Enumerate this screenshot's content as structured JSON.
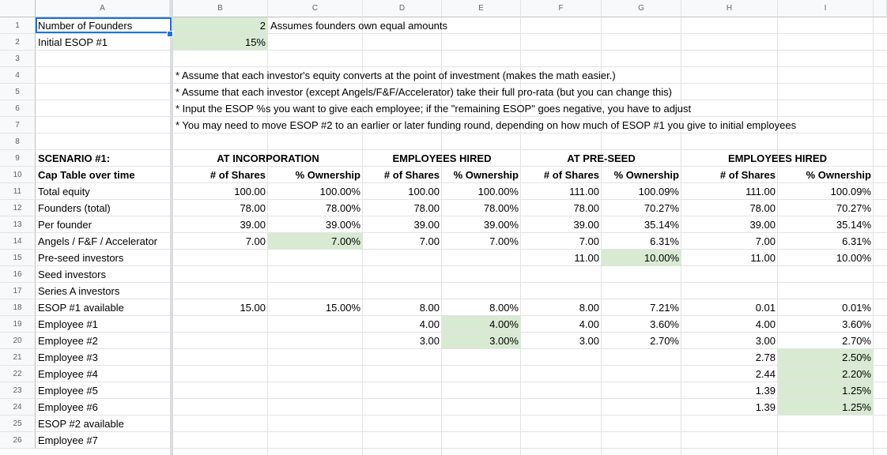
{
  "columns": [
    "A",
    "B",
    "C",
    "D",
    "E",
    "F",
    "G",
    "H",
    "I"
  ],
  "rows": [
    "1",
    "2",
    "3",
    "4",
    "5",
    "6",
    "7",
    "8",
    "9",
    "10",
    "11",
    "12",
    "13",
    "14",
    "15",
    "16",
    "17",
    "18",
    "19",
    "20",
    "21",
    "22",
    "23",
    "24",
    "25",
    "26"
  ],
  "inputs": {
    "founders_label": "Number of Founders",
    "founders_value": "2",
    "founders_note": "Assumes founders own equal amounts",
    "esop_label": "Initial ESOP #1",
    "esop_value": "15%"
  },
  "notes": [
    "* Assume that each investor's equity converts at the point of investment (makes the math easier.)",
    "* Assume that each investor (except Angels/F&F/Accelerator) take their full pro-rata (but you can change this)",
    "* Input the ESOP %s you want to give each employee; if the \"remaining ESOP\" goes negative, you have to adjust",
    "* You may need to move ESOP #2 to an earlier or later funding round, depending on how much of ESOP #1 you give to initial employees"
  ],
  "scenario": {
    "title": "SCENARIO #1:",
    "subtitle": "Cap Table over time",
    "stages": [
      "AT INCORPORATION",
      "EMPLOYEES HIRED",
      "AT PRE-SEED",
      "EMPLOYEES HIRED"
    ],
    "shares_header": "# of Shares",
    "ownership_header": "% Ownership"
  },
  "table": [
    {
      "label": "Total equity",
      "v": [
        "100.00",
        "100.00%",
        "100.00",
        "100.00%",
        "111.00",
        "100.09%",
        "111.00",
        "100.09%"
      ]
    },
    {
      "label": "Founders (total)",
      "v": [
        "78.00",
        "78.00%",
        "78.00",
        "78.00%",
        "78.00",
        "70.27%",
        "78.00",
        "70.27%"
      ]
    },
    {
      "label": "Per founder",
      "v": [
        "39.00",
        "39.00%",
        "39.00",
        "39.00%",
        "39.00",
        "35.14%",
        "39.00",
        "35.14%"
      ]
    },
    {
      "label": "Angels / F&F / Accelerator",
      "v": [
        "7.00",
        "7.00%",
        "7.00",
        "7.00%",
        "7.00",
        "6.31%",
        "7.00",
        "6.31%"
      ]
    },
    {
      "label": "Pre-seed investors",
      "v": [
        "",
        "",
        "",
        "",
        "11.00",
        "10.00%",
        "11.00",
        "10.00%"
      ]
    },
    {
      "label": "Seed investors",
      "v": [
        "",
        "",
        "",
        "",
        "",
        "",
        "",
        ""
      ]
    },
    {
      "label": "Series A investors",
      "v": [
        "",
        "",
        "",
        "",
        "",
        "",
        "",
        ""
      ]
    },
    {
      "label": "ESOP #1 available",
      "v": [
        "15.00",
        "15.00%",
        "8.00",
        "8.00%",
        "8.00",
        "7.21%",
        "0.01",
        "0.01%"
      ]
    },
    {
      "label": "Employee #1",
      "v": [
        "",
        "",
        "4.00",
        "4.00%",
        "4.00",
        "3.60%",
        "4.00",
        "3.60%"
      ]
    },
    {
      "label": "Employee #2",
      "v": [
        "",
        "",
        "3.00",
        "3.00%",
        "3.00",
        "2.70%",
        "3.00",
        "2.70%"
      ]
    },
    {
      "label": "Employee #3",
      "v": [
        "",
        "",
        "",
        "",
        "",
        "",
        "2.78",
        "2.50%"
      ]
    },
    {
      "label": "Employee #4",
      "v": [
        "",
        "",
        "",
        "",
        "",
        "",
        "2.44",
        "2.20%"
      ]
    },
    {
      "label": "Employee #5",
      "v": [
        "",
        "",
        "",
        "",
        "",
        "",
        "1.39",
        "1.25%"
      ]
    },
    {
      "label": "Employee #6",
      "v": [
        "",
        "",
        "",
        "",
        "",
        "",
        "1.39",
        "1.25%"
      ]
    },
    {
      "label": "ESOP #2 available",
      "v": [
        "",
        "",
        "",
        "",
        "",
        "",
        "",
        ""
      ]
    },
    {
      "label": "Employee #7",
      "v": [
        "",
        "",
        "",
        "",
        "",
        "",
        "",
        ""
      ]
    }
  ],
  "colors": {
    "highlight": "#d9ead3",
    "selection": "#1a73e8",
    "header_bg": "#f8f9fa",
    "grid": "#e2e3e3"
  }
}
